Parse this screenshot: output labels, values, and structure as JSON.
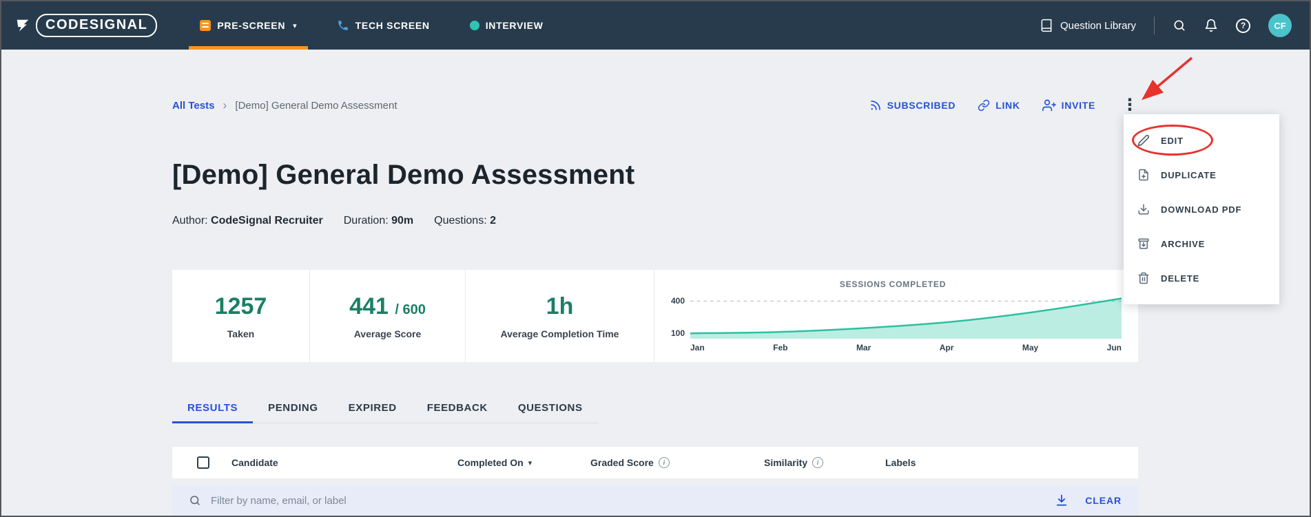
{
  "nav": {
    "logo": "CODESIGNAL",
    "items": [
      {
        "label": "PRE-SCREEN"
      },
      {
        "label": "TECH SCREEN"
      },
      {
        "label": "INTERVIEW"
      }
    ],
    "question_library": "Question Library",
    "avatar": "CF"
  },
  "breadcrumb": {
    "root": "All Tests",
    "current": "[Demo] General Demo Assessment"
  },
  "actions": {
    "subscribed": "SUBSCRIBED",
    "link": "LINK",
    "invite": "INVITE"
  },
  "menu": {
    "items": [
      {
        "label": "EDIT",
        "icon": "pencil-icon"
      },
      {
        "label": "DUPLICATE",
        "icon": "duplicate-icon"
      },
      {
        "label": "DOWNLOAD PDF",
        "icon": "download-icon"
      },
      {
        "label": "ARCHIVE",
        "icon": "archive-icon"
      },
      {
        "label": "DELETE",
        "icon": "trash-icon"
      }
    ]
  },
  "page": {
    "title": "[Demo] General Demo Assessment"
  },
  "meta": {
    "author_label": "Author:",
    "author": "CodeSignal Recruiter",
    "duration_label": "Duration:",
    "duration": "90m",
    "questions_label": "Questions:",
    "questions": "2"
  },
  "stats": [
    {
      "value": "1257",
      "label": "Taken"
    },
    {
      "value": "441",
      "suffix": "/ 600",
      "label": "Average Score"
    },
    {
      "value": "1h",
      "label": "Average Completion Time"
    }
  ],
  "chart_data": {
    "type": "area",
    "title": "SESSIONS COMPLETED",
    "x": [
      "Jan",
      "Feb",
      "Mar",
      "Apr",
      "May",
      "Jun"
    ],
    "values": [
      100,
      112,
      148,
      205,
      300,
      425
    ],
    "yticks": [
      400,
      100
    ],
    "ylim": [
      50,
      460
    ],
    "grid_at": 400,
    "legend": "none"
  },
  "tabs": [
    {
      "label": "RESULTS",
      "active": true
    },
    {
      "label": "PENDING",
      "active": false
    },
    {
      "label": "EXPIRED",
      "active": false
    },
    {
      "label": "FEEDBACK",
      "active": false
    },
    {
      "label": "QUESTIONS",
      "active": false
    }
  ],
  "table": {
    "columns": {
      "candidate": "Candidate",
      "completed_on": "Completed On",
      "graded_score": "Graded Score",
      "similarity": "Similarity",
      "labels": "Labels"
    }
  },
  "filter": {
    "placeholder": "Filter by name, email, or label",
    "clear": "CLEAR"
  },
  "colors": {
    "nav_bg": "#283b4c",
    "accent_orange": "#f7941e",
    "link_blue": "#2551d9",
    "stat_green": "#1a7f66",
    "chart_stroke": "#2bc0a0",
    "chart_fill": "rgba(47,199,164,0.32)",
    "annotation_red": "#e8322c",
    "filter_bg": "#e8ebf8"
  }
}
